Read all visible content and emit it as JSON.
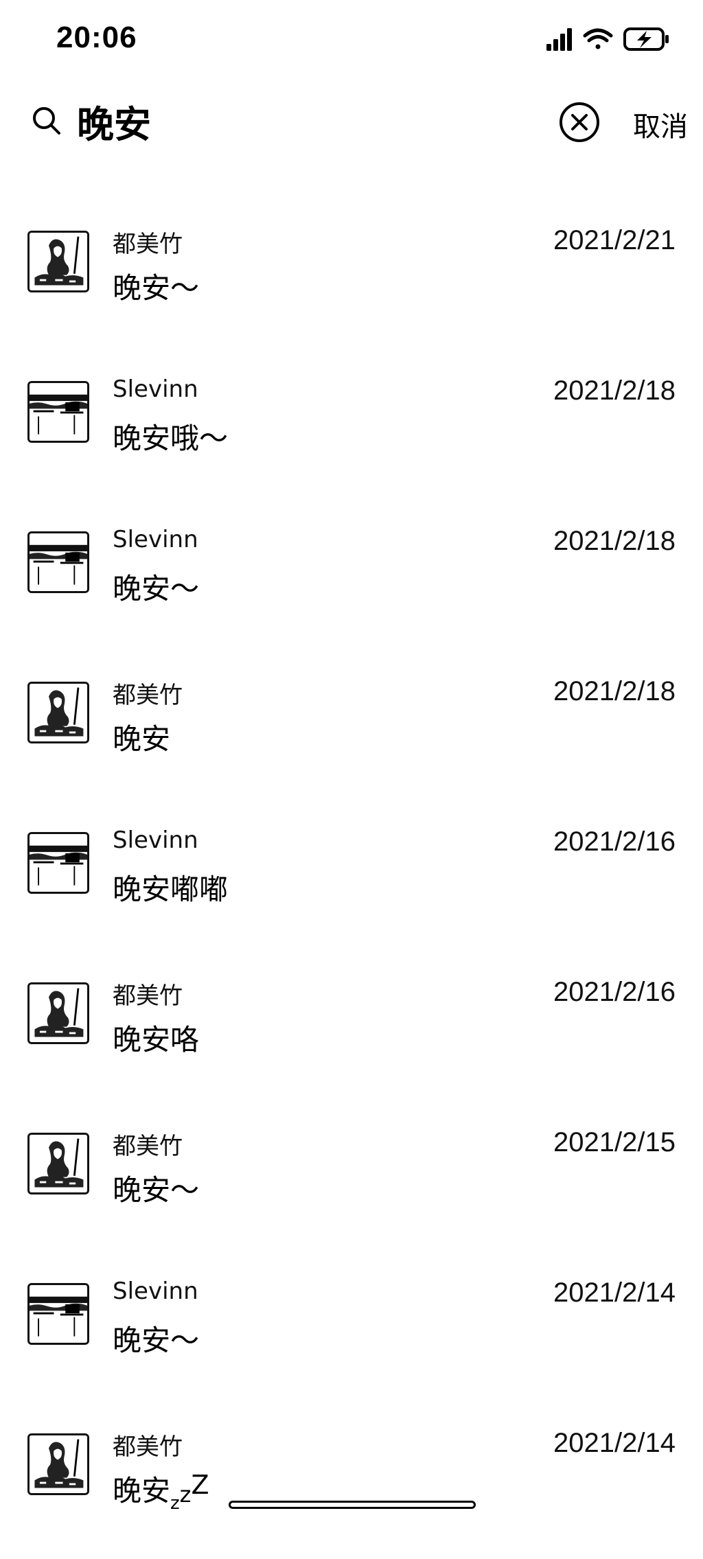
{
  "status_bar": {
    "time": "20:06",
    "icons": [
      "signal-icon",
      "wifi-icon",
      "battery-charging-icon"
    ]
  },
  "search": {
    "query": "晚安",
    "clear_icon": "clear-circle-icon",
    "cancel_label": "取消"
  },
  "avatars": {
    "都美竹": "portrait-avatar",
    "Slevinn": "landscape-avatar"
  },
  "results": [
    {
      "sender": "都美竹",
      "message": "晚安～",
      "date": "2021/2/21"
    },
    {
      "sender": "Slevinn",
      "message": "晚安哦～",
      "date": "2021/2/18"
    },
    {
      "sender": "Slevinn",
      "message": "晚安～",
      "date": "2021/2/18"
    },
    {
      "sender": "都美竹",
      "message": "晚安",
      "date": "2021/2/18"
    },
    {
      "sender": "Slevinn",
      "message": "晚安嘟嘟",
      "date": "2021/2/16"
    },
    {
      "sender": "都美竹",
      "message": "晚安咯",
      "date": "2021/2/16"
    },
    {
      "sender": "都美竹",
      "message": "晚安～",
      "date": "2021/2/15"
    },
    {
      "sender": "Slevinn",
      "message": "晚安～",
      "date": "2021/2/14"
    },
    {
      "sender": "都美竹",
      "message": "晚安",
      "message_suffix": [
        "z",
        "z",
        "Z"
      ],
      "date": "2021/2/14"
    }
  ]
}
